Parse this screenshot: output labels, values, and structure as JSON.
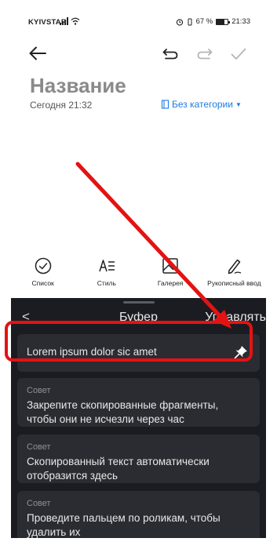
{
  "status_bar": {
    "carrier": "KYIVSTAR",
    "battery": "67 %",
    "battery_level": 0.67,
    "time": "21:33"
  },
  "editor": {
    "title": "Название",
    "date": "Сегодня 21:32",
    "category": "Без категории"
  },
  "tools": [
    {
      "label": "Список",
      "icon": "checkmark-circle-icon"
    },
    {
      "label": "Стиль",
      "icon": "text-style-icon"
    },
    {
      "label": "Галерея",
      "icon": "image-icon"
    },
    {
      "label": "Рукописный ввод",
      "icon": "pen-icon"
    }
  ],
  "clipboard": {
    "title": "Буфер",
    "manage": "Управлять",
    "pinned_item": "Lorem ipsum dolor sic amet",
    "tips": [
      {
        "label": "Совет",
        "text": "Закрепите скопированные фрагменты, чтобы они не исчезли через час"
      },
      {
        "label": "Совет",
        "text": "Скопированный текст автоматически отобразится здесь"
      },
      {
        "label": "Совет",
        "text": "Проведите пальцем по роликам, чтобы удалить их"
      }
    ]
  },
  "colors": {
    "accent": "#1f7be0",
    "annotation": "#e31313",
    "panel_bg": "#1b1c22",
    "card_bg": "#2b2c32"
  }
}
